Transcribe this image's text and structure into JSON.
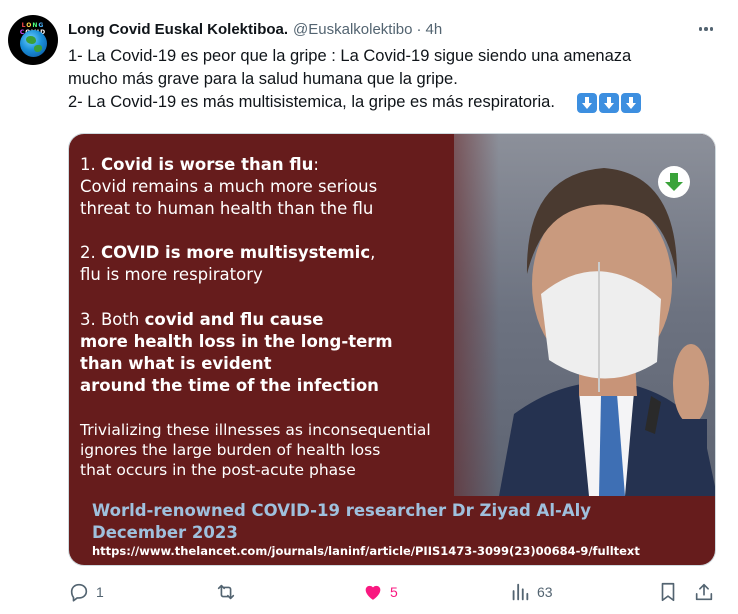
{
  "author": {
    "avatar_text": [
      "L",
      "O",
      "N",
      "G",
      "C"
    ],
    "name": "Long Covid Euskal Kolektiboa.",
    "handle": "@Euskalkolektibo",
    "separator": "·",
    "time": "4h"
  },
  "tweet": {
    "line1": "1- La Covid-19 es peor que la gripe : La Covid-19 sigue siendo una amenaza",
    "line2": "mucho más grave para la salud humana que la gripe.",
    "line3": "2- La Covid-19 es más multisistemica, la gripe es más respiratoria.",
    "emoji_icons": [
      "down-arrow-icon",
      "down-arrow-icon",
      "down-arrow-icon"
    ]
  },
  "image": {
    "p1_prefix": "1. ",
    "p1_bold": "Covid is worse than flu",
    "p1_suffix": ":",
    "p1_line2": "Covid remains a much more serious",
    "p1_line3": "threat to human health than the flu",
    "p2_prefix": "2. ",
    "p2_bold": "COVID is more multisystemic",
    "p2_suffix": ",",
    "p2_line2": "flu is more respiratory",
    "p3_prefix": "3. Both ",
    "p3_bold1": "covid and flu cause",
    "p3_bold2": "more health loss in the long-term",
    "p3_bold3": "than what is evident",
    "p3_bold4": "around the time of the infection",
    "note1": "Trivializing these illnesses as inconsequential",
    "note2": "ignores the large burden of health loss",
    "note3": "that occurs in the post-acute phase",
    "credit1": "World-renowned COVID-19 researcher Dr Ziyad Al-Aly",
    "credit2": "December 2023",
    "url": "https://www.thelancet.com/journals/laninf/article/PIIS1473-3099(23)00684-9/fulltext",
    "badge_icon": "green-down-arrow-icon",
    "panel_color": "#661c1c",
    "credit_color": "#9fc0dd"
  },
  "actions": {
    "replies": "1",
    "retweets": "",
    "likes": "5",
    "views": "63",
    "liked": true,
    "like_color": "#f91880",
    "icons": [
      "reply-icon",
      "retweet-icon",
      "heart-icon",
      "views-icon",
      "bookmark-icon",
      "share-icon"
    ]
  },
  "colors": {
    "text": "#0f1419",
    "muted": "#536471",
    "emoji_blue": "#3d8fe0"
  }
}
